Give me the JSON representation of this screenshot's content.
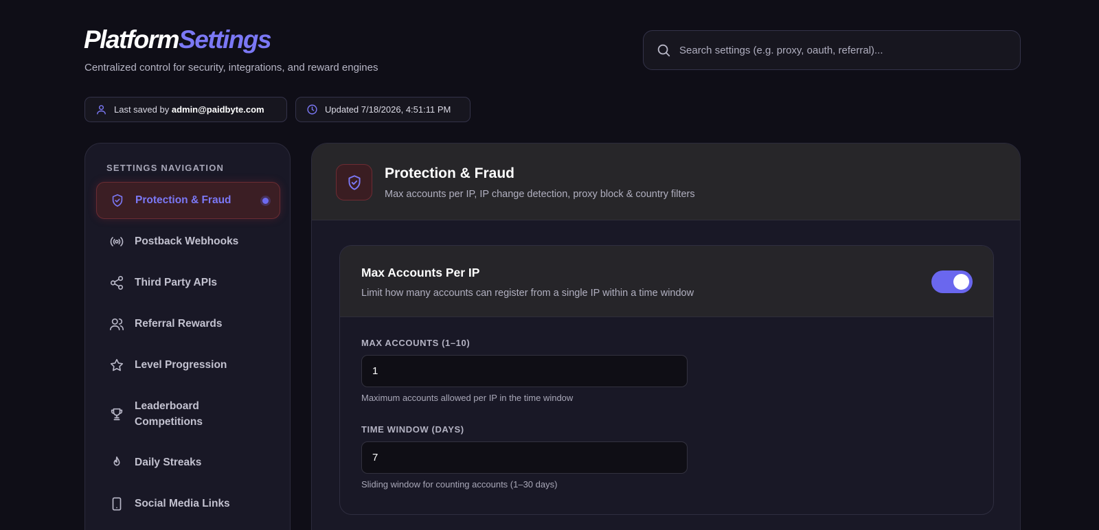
{
  "header": {
    "brand_part1": "Platform",
    "brand_part2": "Settings",
    "subtitle": "Centralized control for security, integrations, and reward engines"
  },
  "search": {
    "placeholder": "Search settings (e.g. proxy, oauth, referral)...",
    "icon": "search-icon"
  },
  "meta": {
    "saved_prefix": "Last saved by",
    "saved_by": "admin@paidbyte.com",
    "updated_label": "Updated 7/18/2026, 4:51:11 PM"
  },
  "sidebar": {
    "heading": "SETTINGS NAVIGATION",
    "items": [
      {
        "label": "Protection & Fraud",
        "icon": "shield-check-icon",
        "active": true
      },
      {
        "label": "Postback Webhooks",
        "icon": "broadcast-icon",
        "active": false
      },
      {
        "label": "Third Party APIs",
        "icon": "share-icon",
        "active": false
      },
      {
        "label": "Referral Rewards",
        "icon": "users-icon",
        "active": false
      },
      {
        "label": "Level Progression",
        "icon": "star-icon",
        "active": false
      },
      {
        "label": "Leaderboard Competitions",
        "icon": "trophy-icon",
        "active": false
      },
      {
        "label": "Daily Streaks",
        "icon": "flame-icon",
        "active": false
      },
      {
        "label": "Social Media Links",
        "icon": "smartphone-icon",
        "active": false
      }
    ]
  },
  "panel": {
    "title": "Protection & Fraud",
    "description": "Max accounts per IP, IP change detection, proxy block & country filters",
    "card": {
      "title": "Max Accounts Per IP",
      "description": "Limit how many accounts can register from a single IP within a time window",
      "enabled": true,
      "fields": [
        {
          "label": "MAX ACCOUNTS (1–10)",
          "value": "1",
          "help": "Maximum accounts allowed per IP in the time window"
        },
        {
          "label": "TIME WINDOW (DAYS)",
          "value": "7",
          "help": "Sliding window for counting accounts (1–30 days)"
        }
      ]
    }
  },
  "colors": {
    "accent": "#6d6af0",
    "background": "#0f0e17",
    "active_nav_bg": "#3b1e24"
  }
}
